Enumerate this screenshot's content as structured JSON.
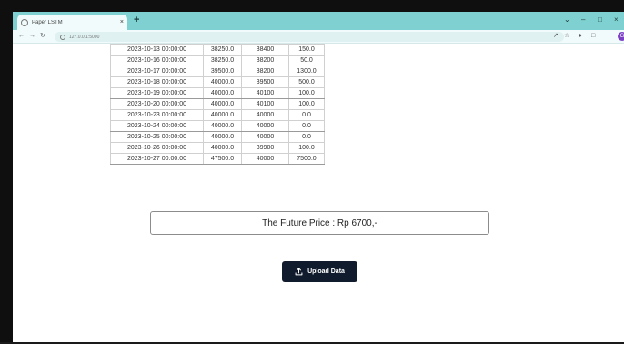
{
  "browser": {
    "tab_title": "Paper LSTM",
    "tab_close": "×",
    "new_tab": "+",
    "url": "127.0.0.1:5000",
    "window_controls": {
      "minimize": "–",
      "maximize": "□",
      "close": "×",
      "chevron": "⌄"
    },
    "profile_initial": "G"
  },
  "table": {
    "rows": [
      [
        "2023-10-13 00:00:00",
        "38250.0",
        "38400",
        "150.0"
      ],
      [
        "2023-10-16 00:00:00",
        "38250.0",
        "38200",
        "50.0"
      ],
      [
        "2023-10-17 00:00:00",
        "39500.0",
        "38200",
        "1300.0"
      ],
      [
        "2023-10-18 00:00:00",
        "40000.0",
        "39500",
        "500.0"
      ],
      [
        "2023-10-19 00:00:00",
        "40000.0",
        "40100",
        "100.0"
      ],
      [
        "2023-10-20 00:00:00",
        "40000.0",
        "40100",
        "100.0"
      ],
      [
        "2023-10-23 00:00:00",
        "40000.0",
        "40000",
        "0.0"
      ],
      [
        "2023-10-24 00:00:00",
        "40000.0",
        "40000",
        "0.0"
      ],
      [
        "2023-10-25 00:00:00",
        "40000.0",
        "40000",
        "0.0"
      ],
      [
        "2023-10-26 00:00:00",
        "40000.0",
        "39900",
        "100.0"
      ],
      [
        "2023-10-27 00:00:00",
        "47500.0",
        "40000",
        "7500.0"
      ]
    ]
  },
  "prediction": {
    "text": "The Future Price : Rp 6700,-"
  },
  "upload": {
    "label": "Upload Data",
    "icon": "upload-icon"
  },
  "colors": {
    "tabbar": "#7fd0d0",
    "button": "#101c2e",
    "profile": "#7b3fc4"
  }
}
